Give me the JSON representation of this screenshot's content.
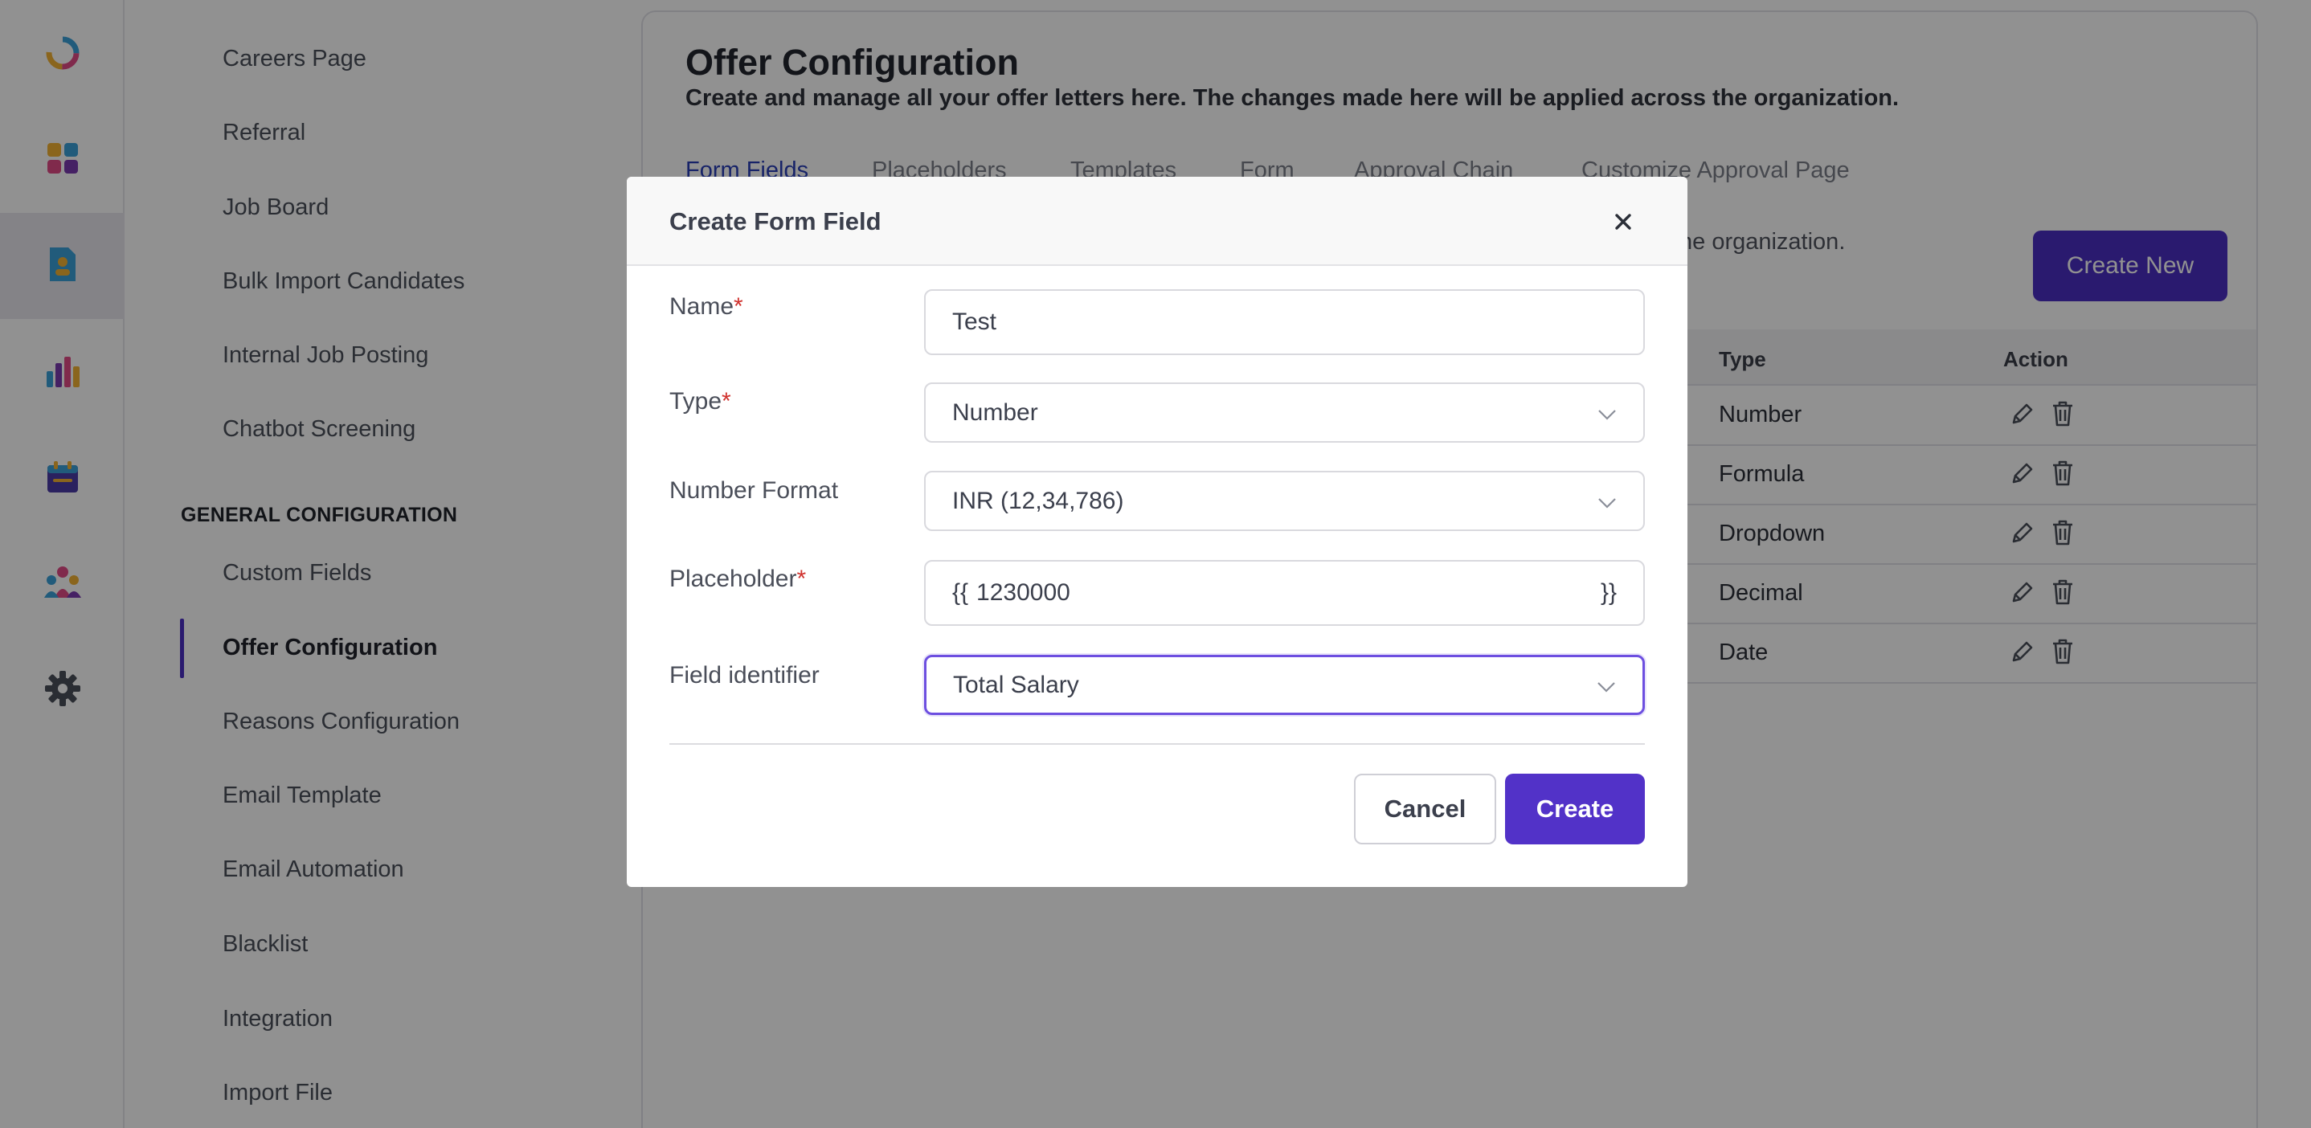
{
  "rail": {
    "icons": [
      "logo-ring-icon",
      "apps-grid-icon",
      "candidate-document-icon",
      "bar-chart-icon",
      "calendar-icon",
      "team-icon",
      "gear-icon"
    ]
  },
  "sidebar": {
    "items_top": [
      {
        "label": "Careers Page"
      },
      {
        "label": "Referral"
      },
      {
        "label": "Job Board"
      },
      {
        "label": "Bulk Import Candidates"
      },
      {
        "label": "Internal Job Posting"
      },
      {
        "label": "Chatbot Screening"
      }
    ],
    "section_title": "GENERAL CONFIGURATION",
    "items_bottom": [
      {
        "label": "Custom Fields"
      },
      {
        "label": "Offer Configuration"
      },
      {
        "label": "Reasons Configuration"
      },
      {
        "label": "Email Template"
      },
      {
        "label": "Email Automation"
      },
      {
        "label": "Blacklist"
      },
      {
        "label": "Integration"
      },
      {
        "label": "Import File"
      }
    ]
  },
  "main": {
    "title": "Offer Configuration",
    "subtitle": "Create and manage all your offer letters here. The changes made here will be applied across the organization.",
    "tabs": [
      {
        "label": "Form Fields"
      },
      {
        "label": "Placeholders"
      },
      {
        "label": "Templates"
      },
      {
        "label": "Form"
      },
      {
        "label": "Approval Chain"
      },
      {
        "label": "Customize Approval Page"
      }
    ],
    "tab_description_visible": "he organization.",
    "create_new_label": "Create New",
    "table": {
      "columns": {
        "type": "Type",
        "action": "Action"
      },
      "rows": [
        {
          "type": "Number"
        },
        {
          "type": "Formula"
        },
        {
          "type": "Dropdown"
        },
        {
          "type": "Decimal"
        },
        {
          "type": "Date"
        }
      ]
    }
  },
  "modal": {
    "title": "Create Form Field",
    "fields": {
      "name": {
        "label": "Name",
        "required": "*",
        "value": "Test"
      },
      "type": {
        "label": "Type",
        "required": "*",
        "value": "Number"
      },
      "number_format": {
        "label": "Number Format",
        "value": "INR (12,34,786)"
      },
      "placeholder": {
        "label": "Placeholder",
        "required": "*",
        "prefix": "{{",
        "value": "1230000",
        "suffix": "}}"
      },
      "field_identifier": {
        "label": "Field identifier",
        "value": "Total Salary"
      }
    },
    "cancel_label": "Cancel",
    "create_label": "Create"
  },
  "colors": {
    "accent": "#4b2ec4",
    "required": "#d0312d",
    "focus_border": "#6d4fe0"
  }
}
